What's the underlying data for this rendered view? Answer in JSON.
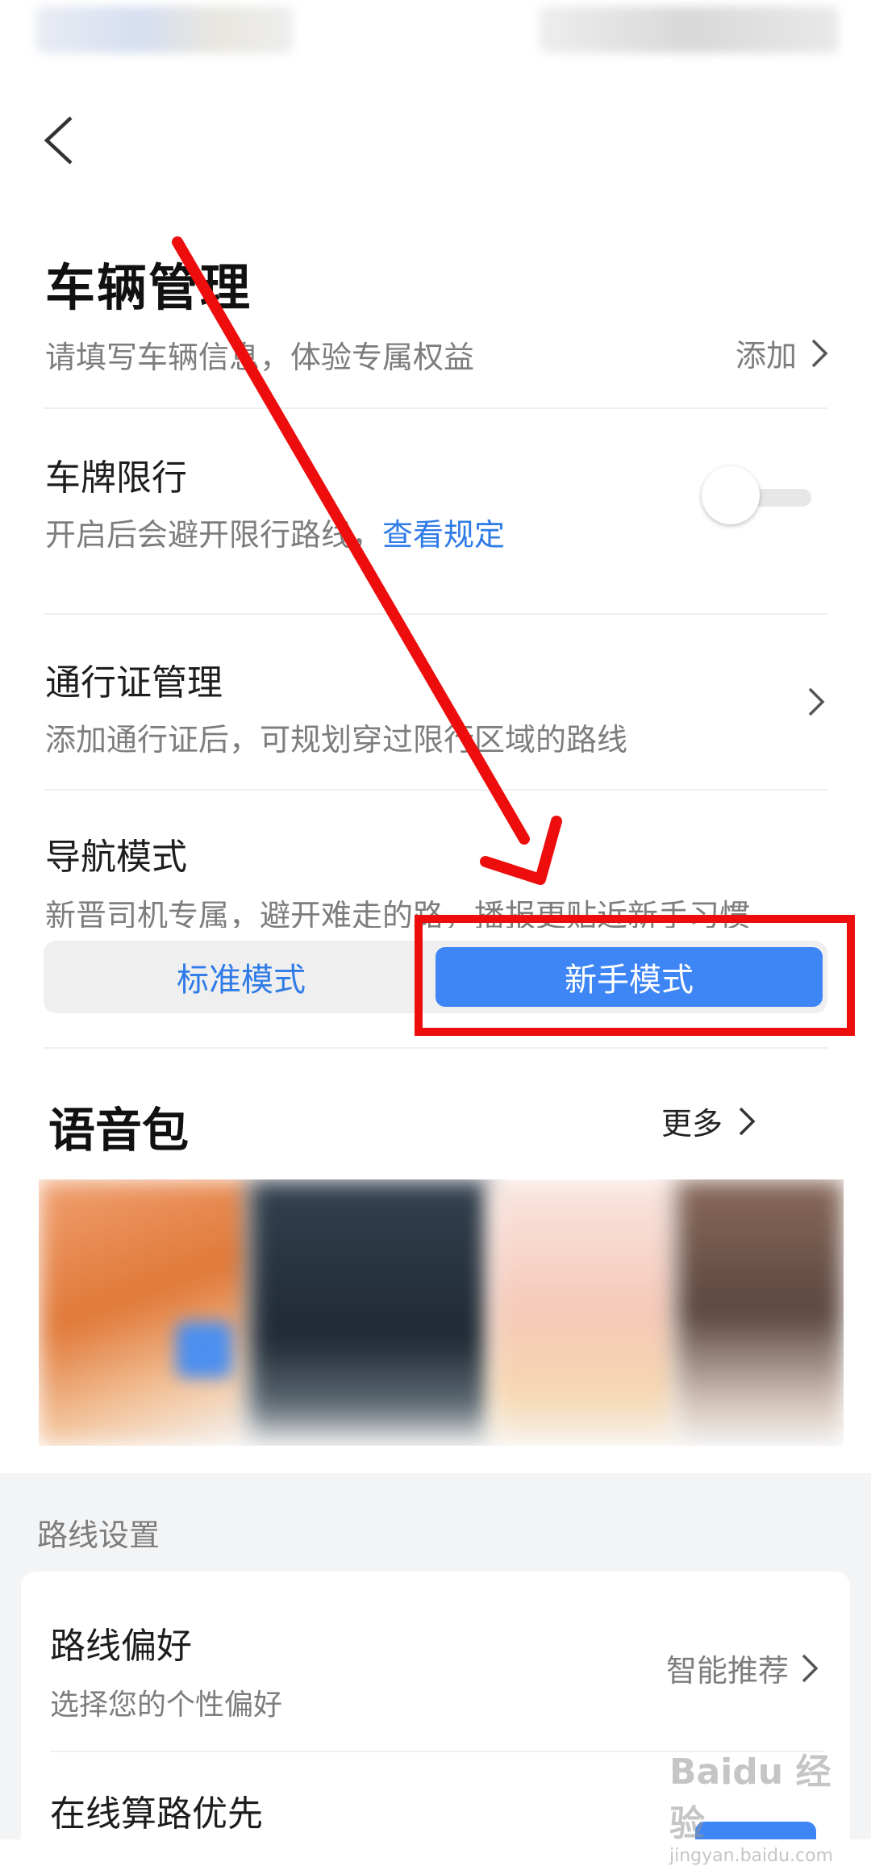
{
  "vehicle": {
    "title": "车辆管理",
    "subtitle": "请填写车辆信息，体验专属权益",
    "add_label": "添加"
  },
  "plate_limit": {
    "title": "车牌限行",
    "desc": "开启后会避开限行路线，",
    "link": "查看规定",
    "enabled": false
  },
  "pass_manage": {
    "title": "通行证管理",
    "desc": "添加通行证后，可规划穿过限行区域的路线"
  },
  "nav_mode": {
    "title": "导航模式",
    "desc": "新晋司机专属，避开难走的路，播报更贴近新手习惯",
    "options": [
      "标准模式",
      "新手模式"
    ],
    "selected": "新手模式"
  },
  "voice": {
    "title": "语音包",
    "more_label": "更多"
  },
  "route_settings": {
    "section_label": "路线设置",
    "preference_title": "路线偏好",
    "preference_desc": "选择您的个性偏好",
    "preference_value": "智能推荐",
    "online_title": "在线算路优先"
  },
  "watermark": {
    "text": "Baidu 经验",
    "sub": "jingyan.baidu.com"
  },
  "colors": {
    "accent": "#3e85f6",
    "link": "#2f7be8",
    "annotation_red": "#ee0d0d"
  }
}
